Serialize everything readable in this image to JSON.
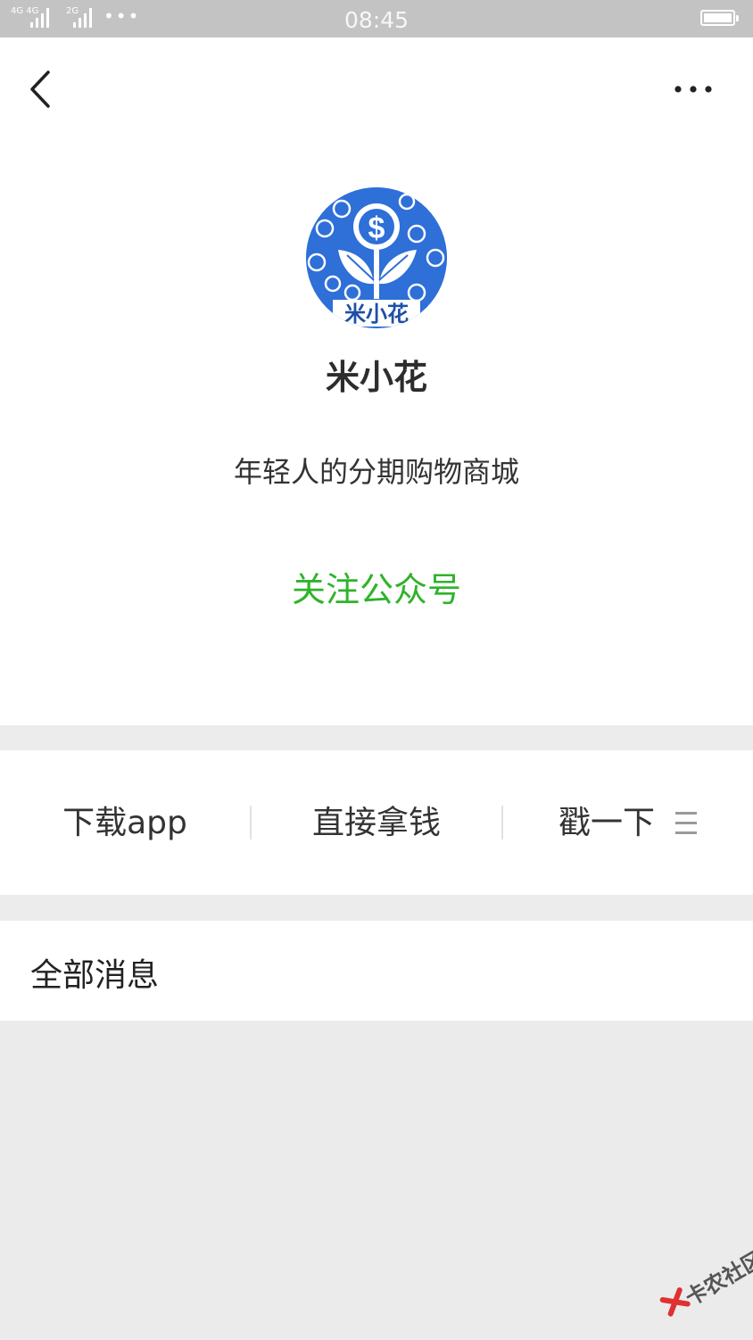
{
  "status_bar": {
    "sim1_label": "4G 4G",
    "sim2_label": "2G",
    "more_dots": "•••",
    "time": "08:45"
  },
  "header": {
    "back_icon": "chevron-left-icon",
    "more_icon": "more-dots-icon"
  },
  "account": {
    "logo_text": "米小花",
    "name": "米小花",
    "description": "年轻人的分期购物商城",
    "follow_label": "关注公众号"
  },
  "menu": {
    "items": [
      {
        "label": "下载app"
      },
      {
        "label": "直接拿钱"
      },
      {
        "label": "戳一下"
      }
    ],
    "list_icon": "list-icon"
  },
  "messages": {
    "title": "全部消息"
  },
  "watermark": {
    "text": "卡农社区"
  },
  "colors": {
    "accent_green": "#2fb32a",
    "logo_blue": "#2e6fd8",
    "status_bar_bg": "#c3c3c3",
    "page_bg": "#ececec"
  }
}
